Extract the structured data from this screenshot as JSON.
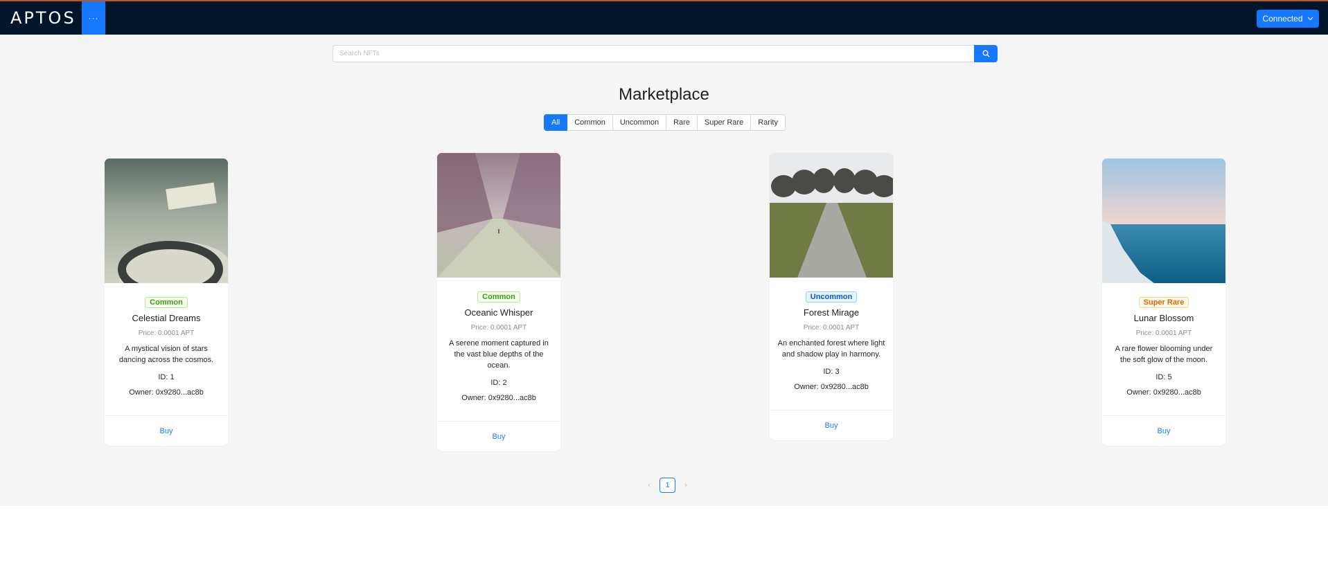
{
  "header": {
    "logo_text": "APTOS",
    "menu_label": "···",
    "connect_label": "Connected"
  },
  "search": {
    "placeholder": "Search NFTs"
  },
  "title": "Marketplace",
  "filters": [
    "All",
    "Common",
    "Uncommon",
    "Rare",
    "Super Rare",
    "Rarity"
  ],
  "cards": [
    {
      "rarity": "Common",
      "name": "Celestial Dreams",
      "price": "Price: 0.0001 APT",
      "description": "A mystical vision of stars dancing across the cosmos.",
      "id": "ID: 1",
      "owner": "Owner: 0x9280...ac8b",
      "buy": "Buy"
    },
    {
      "rarity": "Common",
      "name": "Oceanic Whisper",
      "price": "Price: 0.0001 APT",
      "description": "A serene moment captured in the vast blue depths of the ocean.",
      "id": "ID: 2",
      "owner": "Owner: 0x9280...ac8b",
      "buy": "Buy"
    },
    {
      "rarity": "Uncommon",
      "name": "Forest Mirage",
      "price": "Price: 0.0001 APT",
      "description": "An enchanted forest where light and shadow play in harmony.",
      "id": "ID: 3",
      "owner": "Owner: 0x9280...ac8b",
      "buy": "Buy"
    },
    {
      "rarity": "Super Rare",
      "name": "Lunar Blossom",
      "price": "Price: 0.0001 APT",
      "description": "A rare flower blooming under the soft glow of the moon.",
      "id": "ID: 5",
      "owner": "Owner: 0x9280...ac8b",
      "buy": "Buy"
    }
  ],
  "pagination": {
    "current": "1",
    "prev": "‹",
    "next": "›"
  },
  "colors": {
    "header_bg": "#001529",
    "accent": "#1677ff",
    "page_bg": "#f5f5f5"
  }
}
